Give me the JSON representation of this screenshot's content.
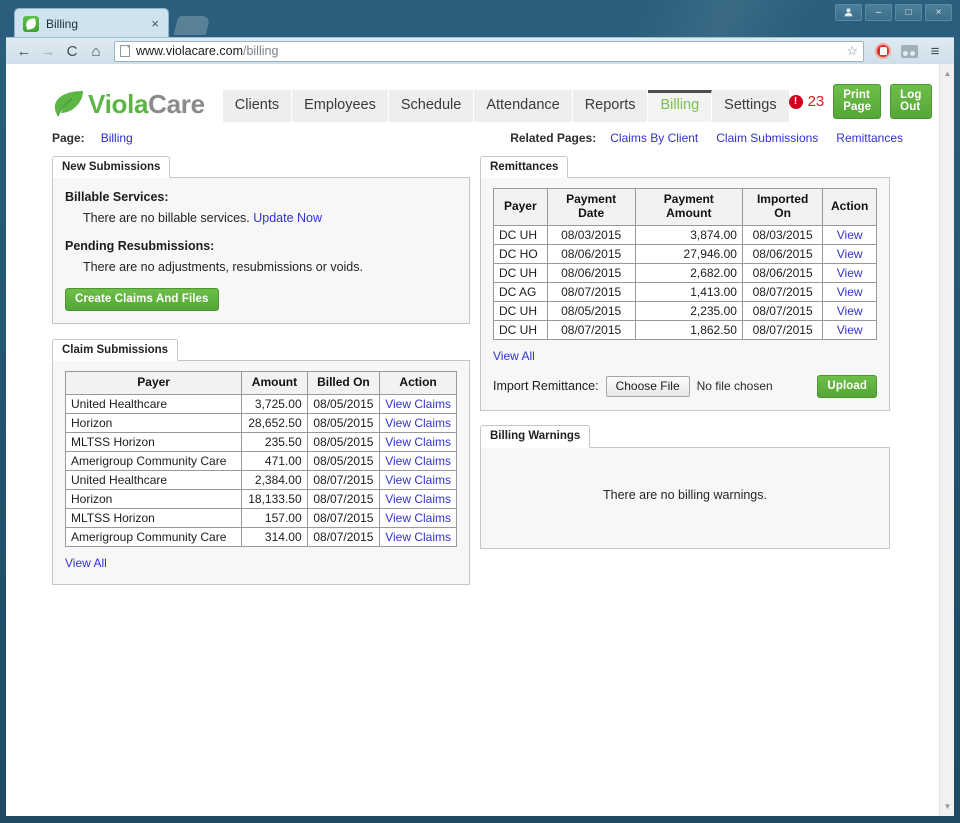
{
  "browser": {
    "tab_title": "Billing",
    "tab_close": "×",
    "back_icon": "←",
    "forward_icon": "→",
    "reload_icon": "C",
    "home_icon": "⌂",
    "star_icon": "☆",
    "menu_icon": "≡",
    "url_host": "www.violacare.com",
    "url_path": "/billing",
    "window_minimize": "–",
    "window_maximize": "□",
    "window_close": "×",
    "scroll_up": "▲",
    "scroll_down": "▼"
  },
  "header": {
    "logo_primary": "Viola",
    "logo_secondary": "Care",
    "nav": [
      {
        "label": "Clients",
        "active": false
      },
      {
        "label": "Employees",
        "active": false
      },
      {
        "label": "Schedule",
        "active": false
      },
      {
        "label": "Attendance",
        "active": false
      },
      {
        "label": "Reports",
        "active": false
      },
      {
        "label": "Billing",
        "active": true
      },
      {
        "label": "Settings",
        "active": false
      }
    ],
    "alert_icon": "!",
    "alert_count": "23",
    "print_label": "Print Page",
    "logout_label": "Log Out"
  },
  "crumbs": {
    "page_label": "Page:",
    "page_value": "Billing",
    "related_label": "Related Pages:",
    "related_links": [
      "Claims By Client",
      "Claim Submissions",
      "Remittances"
    ]
  },
  "new_submissions": {
    "tab": "New Submissions",
    "billable_title": "Billable Services:",
    "billable_text": "There are no billable services.",
    "billable_link": "Update Now",
    "pending_title": "Pending Resubmissions:",
    "pending_text": "There are no adjustments, resubmissions or voids.",
    "create_button": "Create Claims And Files"
  },
  "claim_submissions": {
    "tab": "Claim Submissions",
    "columns": [
      "Payer",
      "Amount",
      "Billed On",
      "Action"
    ],
    "rows": [
      {
        "payer": "United Healthcare",
        "amount": "3,725.00",
        "billed_on": "08/05/2015",
        "action": "View Claims"
      },
      {
        "payer": "Horizon",
        "amount": "28,652.50",
        "billed_on": "08/05/2015",
        "action": "View Claims"
      },
      {
        "payer": "MLTSS Horizon",
        "amount": "235.50",
        "billed_on": "08/05/2015",
        "action": "View Claims"
      },
      {
        "payer": "Amerigroup Community Care",
        "amount": "471.00",
        "billed_on": "08/05/2015",
        "action": "View Claims"
      },
      {
        "payer": "United Healthcare",
        "amount": "2,384.00",
        "billed_on": "08/07/2015",
        "action": "View Claims"
      },
      {
        "payer": "Horizon",
        "amount": "18,133.50",
        "billed_on": "08/07/2015",
        "action": "View Claims"
      },
      {
        "payer": "MLTSS Horizon",
        "amount": "157.00",
        "billed_on": "08/07/2015",
        "action": "View Claims"
      },
      {
        "payer": "Amerigroup Community Care",
        "amount": "314.00",
        "billed_on": "08/07/2015",
        "action": "View Claims"
      }
    ],
    "view_all": "View All"
  },
  "remittances": {
    "tab": "Remittances",
    "columns": [
      "Payer",
      "Payment Date",
      "Payment Amount",
      "Imported On",
      "Action"
    ],
    "rows": [
      {
        "payer": "DC UH",
        "payment_date": "08/03/2015",
        "payment_amount": "3,874.00",
        "imported_on": "08/03/2015",
        "action": "View"
      },
      {
        "payer": "DC HO",
        "payment_date": "08/06/2015",
        "payment_amount": "27,946.00",
        "imported_on": "08/06/2015",
        "action": "View"
      },
      {
        "payer": "DC UH",
        "payment_date": "08/06/2015",
        "payment_amount": "2,682.00",
        "imported_on": "08/06/2015",
        "action": "View"
      },
      {
        "payer": "DC AG",
        "payment_date": "08/07/2015",
        "payment_amount": "1,413.00",
        "imported_on": "08/07/2015",
        "action": "View"
      },
      {
        "payer": "DC UH",
        "payment_date": "08/05/2015",
        "payment_amount": "2,235.00",
        "imported_on": "08/07/2015",
        "action": "View"
      },
      {
        "payer": "DC UH",
        "payment_date": "08/07/2015",
        "payment_amount": "1,862.50",
        "imported_on": "08/07/2015",
        "action": "View"
      }
    ],
    "view_all": "View All",
    "import_label": "Import Remittance:",
    "choose_file": "Choose File",
    "file_status": "No file chosen",
    "upload_label": "Upload"
  },
  "billing_warnings": {
    "tab": "Billing Warnings",
    "empty_text": "There are no billing warnings."
  },
  "colors": {
    "brand_green": "#5cb544",
    "button_green": "#55a636",
    "link_blue": "#3333cc",
    "alert_red": "#d0021b",
    "chrome_blue": "#1e4a64"
  }
}
